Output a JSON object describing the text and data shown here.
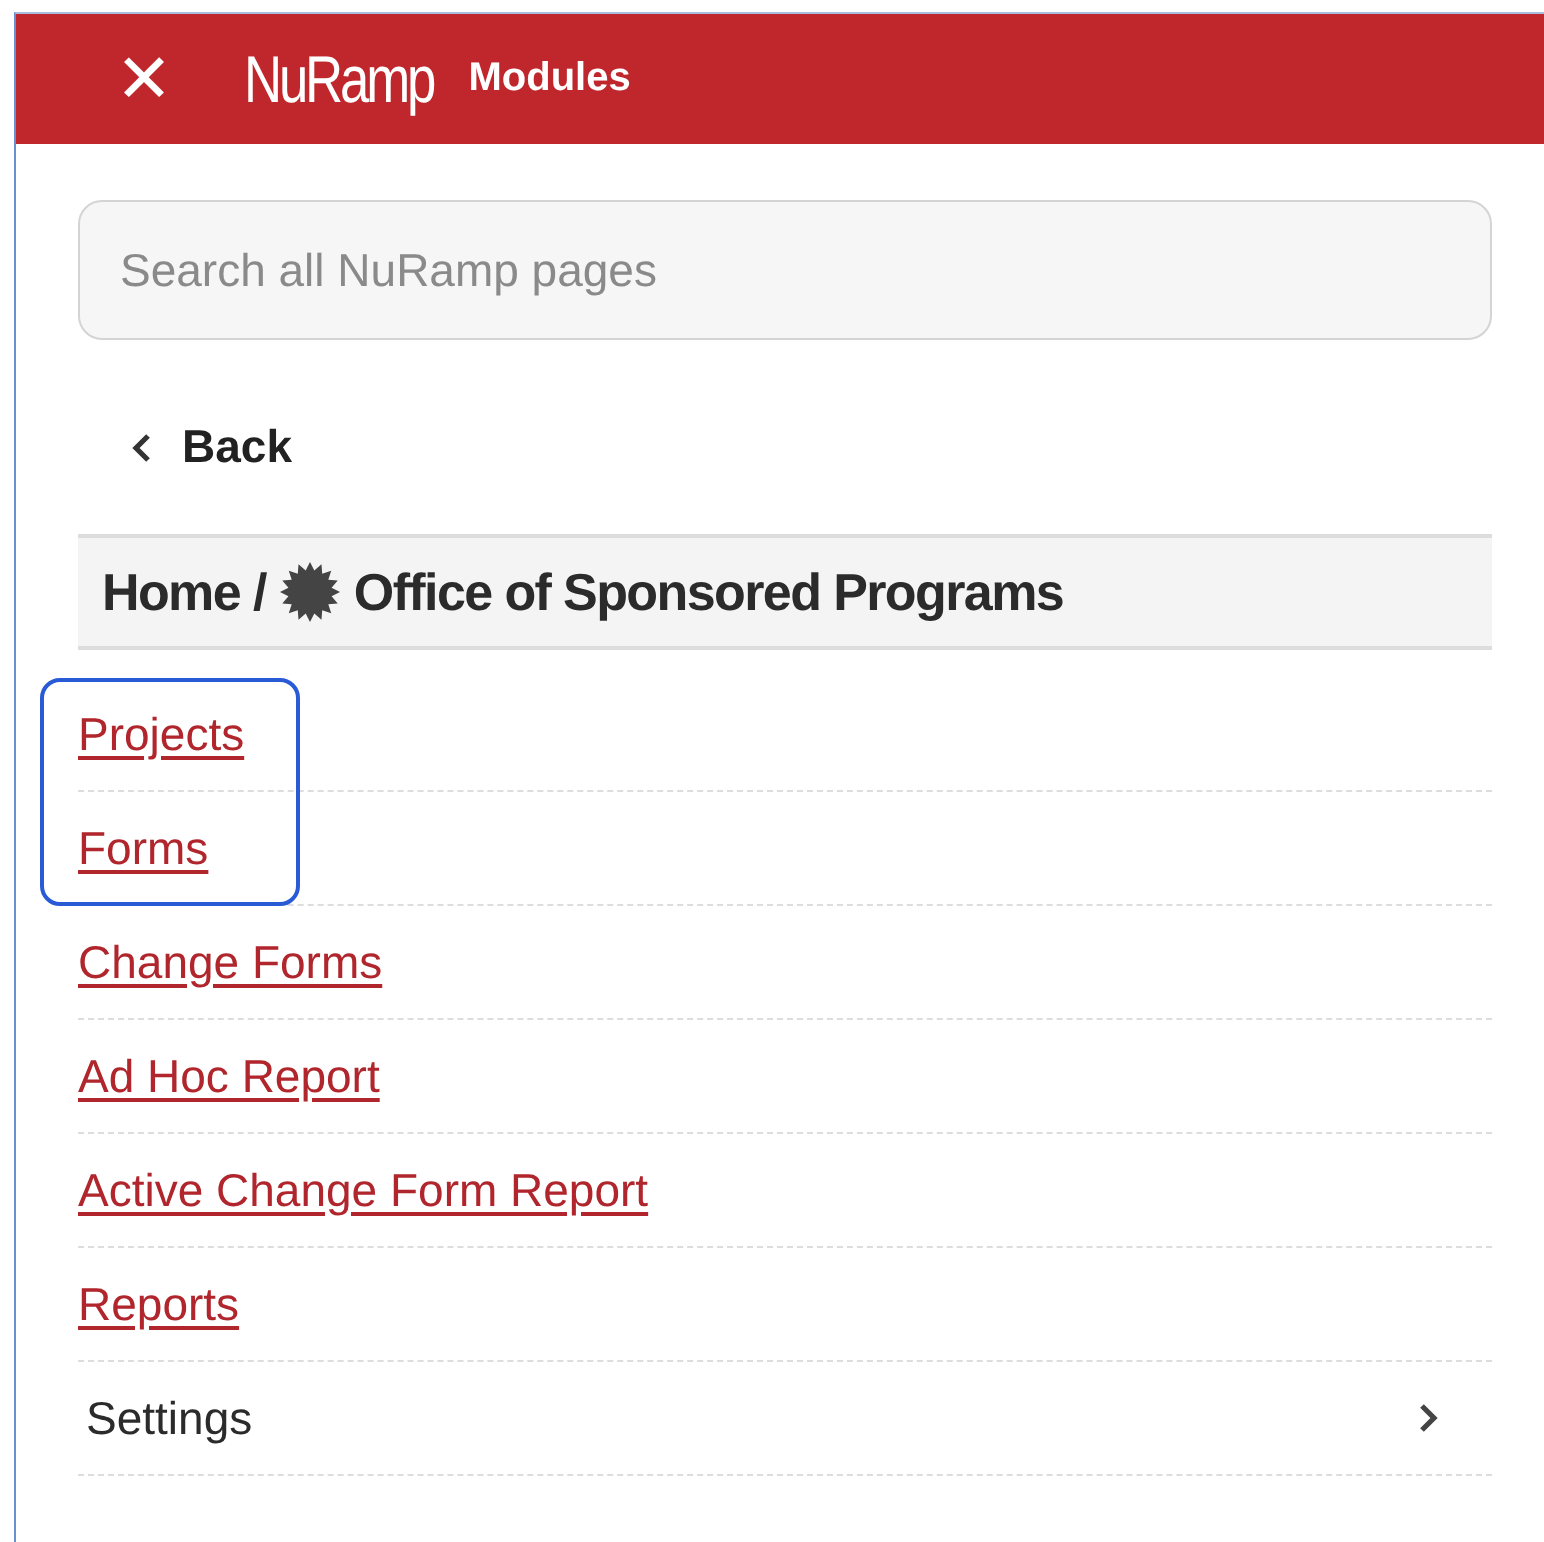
{
  "header": {
    "close": "✕",
    "logo": "NuRamp",
    "title": "Modules"
  },
  "search": {
    "placeholder": "Search all NuRamp pages"
  },
  "back": {
    "label": "Back"
  },
  "breadcrumb": {
    "home": "Home /",
    "current": "Office of Sponsored Programs"
  },
  "items": [
    {
      "kind": "link",
      "label": "Projects",
      "highlighted": true
    },
    {
      "kind": "link",
      "label": "Forms",
      "highlighted": true
    },
    {
      "kind": "link",
      "label": "Change Forms",
      "highlighted": false
    },
    {
      "kind": "link",
      "label": "Ad Hoc Report",
      "highlighted": false
    },
    {
      "kind": "link",
      "label": "Active Change Form Report",
      "highlighted": false
    },
    {
      "kind": "link",
      "label": "Reports",
      "highlighted": false
    },
    {
      "kind": "submenu",
      "label": "Settings",
      "highlighted": false
    }
  ]
}
